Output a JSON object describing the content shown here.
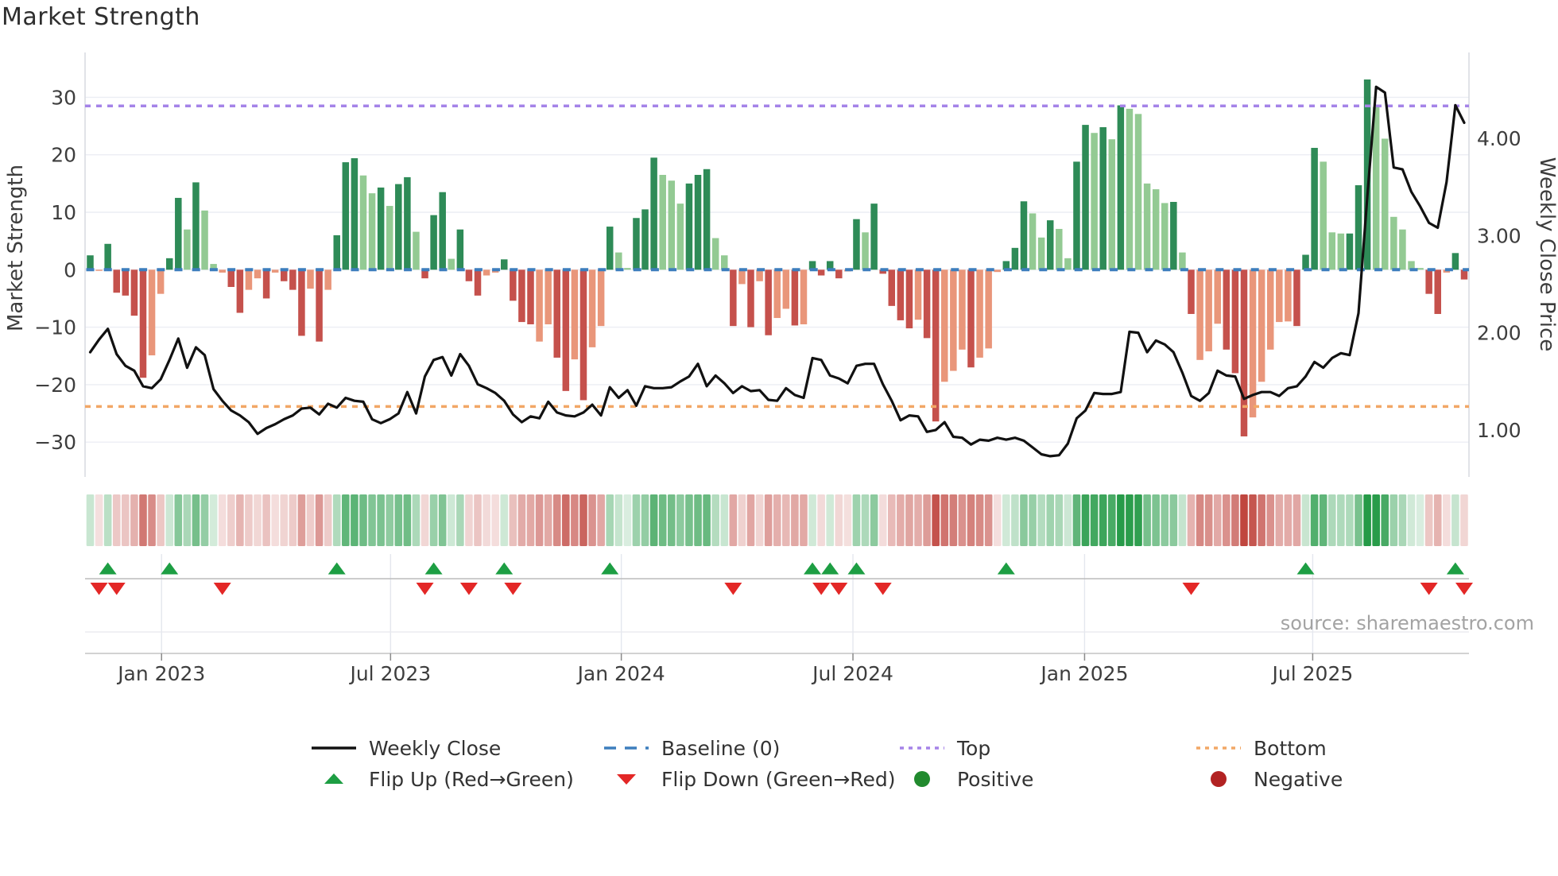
{
  "header": {
    "title": "Market Strength"
  },
  "source": "source: sharemaestro.com",
  "colors": {
    "bar_pos_dark": "#2e8b57",
    "bar_pos_light": "#93ca93",
    "bar_neg_dark": "#c5514c",
    "bar_neg_light": "#e9967a",
    "price_line": "#111111",
    "baseline": "#3d7ebd",
    "top_line": "#a583e8",
    "bottom_line": "#f2a766",
    "flip_up": "#1d9e43",
    "flip_down": "#e32726",
    "positive_dot": "#218a2e",
    "negative_dot": "#b22222",
    "heat_green": "#259a47",
    "heat_red": "#c0463f",
    "grid": "#eceef4",
    "spine": "#d7dae1",
    "axis_text": "#3d3d3d",
    "source_text": "#a3a3a3"
  },
  "chart_data": {
    "type": "bar",
    "subtype": "strength-bars + price line + heatmap + flip markers",
    "title": "Market Strength",
    "frequency": "weekly",
    "start_week": "2022-11-06",
    "n_weeks": 157,
    "left_axis": {
      "label": "Market Strength",
      "tick_labels": [
        "30",
        "20",
        "10",
        "0",
        "−10",
        "−20",
        "−30"
      ],
      "tick_values": [
        30,
        20,
        10,
        0,
        -10,
        -20,
        -30
      ],
      "range": [
        -37,
        37.8
      ]
    },
    "right_axis": {
      "label": "Weekly Close Price",
      "tick_labels": [
        "4.00",
        "3.00",
        "2.00",
        "1.00"
      ],
      "tick_values": [
        4,
        3,
        2,
        1
      ]
    },
    "x_ticks": [
      {
        "label": "Jan 2023",
        "week": 8.1
      },
      {
        "label": "Jul 2023",
        "week": 34.1
      },
      {
        "label": "Jan 2024",
        "week": 60.3
      },
      {
        "label": "Jul 2024",
        "week": 86.6
      },
      {
        "label": "Jan 2025",
        "week": 112.9
      },
      {
        "label": "Jul 2025",
        "week": 138.8
      }
    ],
    "baseline_value": 0,
    "top_value": 28.5,
    "bottom_value": -23.8,
    "strength": [
      2.5,
      -0.2,
      4.5,
      -4,
      -4.5,
      -8,
      -18.8,
      -14.9,
      -4.2,
      2,
      12.5,
      7,
      15.2,
      10.3,
      1,
      -0.5,
      -3,
      -7.5,
      -3.5,
      -1.5,
      -5,
      -0.5,
      -2,
      -3.5,
      -11.5,
      -3.3,
      -12.5,
      -3.5,
      6,
      18.7,
      19.4,
      16.4,
      13.3,
      14.3,
      11.1,
      14.9,
      16.1,
      6.6,
      -1.5,
      9.5,
      13.5,
      1.9,
      7,
      -2,
      -4.5,
      -1,
      -0.5,
      1.8,
      -5.4,
      -9.1,
      -9.5,
      -12.5,
      -9.5,
      -15.3,
      -21.1,
      -15.6,
      -22.7,
      -13.5,
      -9.8,
      7.5,
      3,
      0.3,
      9,
      10.5,
      19.5,
      16.5,
      15.5,
      11.5,
      15,
      16.5,
      17.5,
      5.5,
      2.5,
      -9.8,
      -2.5,
      -10,
      -2,
      -11.4,
      -8.4,
      -6.8,
      -9.7,
      -9.5,
      1.5,
      -1,
      1.5,
      -1.5,
      -0.3,
      8.8,
      6.5,
      11.5,
      -0.7,
      -6.3,
      -8.8,
      -10.2,
      -8.7,
      -11.9,
      -26.4,
      -19.5,
      -17.6,
      -13.9,
      -17,
      -15.3,
      -13.7,
      -0.4,
      1.5,
      3.8,
      11.9,
      9.8,
      5.6,
      8.6,
      7.1,
      2,
      18.8,
      25.2,
      23.8,
      24.8,
      22.7,
      28.6,
      28,
      27.1,
      15,
      14,
      11.6,
      11.8,
      3,
      -7.7,
      -15.7,
      -14.2,
      -9.4,
      -13.9,
      -18,
      -29,
      -25.7,
      -19.5,
      -13.9,
      -9.1,
      -9,
      -9.8,
      2.6,
      21.2,
      18.8,
      6.5,
      6.3,
      6.3,
      14.7,
      33.1,
      28.3,
      22.8,
      9.2,
      7,
      1.5,
      0.3,
      -4.2,
      -7.7,
      -0.5,
      2.9,
      -1.7
    ],
    "shade": "DLDDDDDLLDDLDLLLDDLLDLDDDLDLDDDLLDLDDLDDDLDDDLLDDDDLLDDLDLLDLLDDDLLLDDDLLDLDLDLLDLDDDDLDLDDDDDLDDLLLDLLLDDDLLDLLDDLDLDLLLLLDLDLLLDDDLLLLLDDDLLLDDDLLLLLLDDLDD",
    "price": [
      1.8,
      1.93,
      2.04,
      1.78,
      1.66,
      1.61,
      1.45,
      1.43,
      1.52,
      1.72,
      1.94,
      1.64,
      1.85,
      1.77,
      1.42,
      1.3,
      1.2,
      1.15,
      1.08,
      0.96,
      1.02,
      1.06,
      1.11,
      1.15,
      1.22,
      1.23,
      1.16,
      1.27,
      1.23,
      1.33,
      1.3,
      1.29,
      1.11,
      1.07,
      1.11,
      1.17,
      1.39,
      1.17,
      1.55,
      1.72,
      1.75,
      1.56,
      1.78,
      1.66,
      1.47,
      1.43,
      1.38,
      1.3,
      1.16,
      1.08,
      1.14,
      1.12,
      1.29,
      1.18,
      1.15,
      1.14,
      1.18,
      1.26,
      1.15,
      1.44,
      1.33,
      1.41,
      1.25,
      1.45,
      1.43,
      1.43,
      1.44,
      1.5,
      1.55,
      1.68,
      1.45,
      1.56,
      1.48,
      1.38,
      1.45,
      1.4,
      1.41,
      1.31,
      1.3,
      1.43,
      1.36,
      1.33,
      1.74,
      1.72,
      1.56,
      1.53,
      1.48,
      1.66,
      1.68,
      1.68,
      1.47,
      1.3,
      1.1,
      1.15,
      1.14,
      0.98,
      1.0,
      1.08,
      0.93,
      0.92,
      0.85,
      0.9,
      0.89,
      0.92,
      0.9,
      0.92,
      0.89,
      0.82,
      0.75,
      0.73,
      0.74,
      0.86,
      1.12,
      1.2,
      1.38,
      1.37,
      1.37,
      1.39,
      2.01,
      2.0,
      1.8,
      1.92,
      1.88,
      1.8,
      1.59,
      1.35,
      1.3,
      1.38,
      1.61,
      1.56,
      1.55,
      1.32,
      1.36,
      1.39,
      1.39,
      1.35,
      1.43,
      1.45,
      1.55,
      1.7,
      1.64,
      1.74,
      1.79,
      1.77,
      2.2,
      3.4,
      4.53,
      4.47,
      3.7,
      3.68,
      3.45,
      3.3,
      3.13,
      3.08,
      3.55,
      4.34,
      4.16
    ],
    "flip_up_weeks": [
      2,
      9,
      28,
      39,
      47,
      59,
      82,
      84,
      87,
      104,
      138,
      155
    ],
    "flip_down_weeks": [
      1,
      3,
      15,
      38,
      43,
      48,
      73,
      83,
      85,
      90,
      125,
      152,
      156
    ],
    "legend_position": "bottom",
    "grid": "horizontal-only"
  },
  "legend": {
    "rows": [
      [
        {
          "type": "line-black",
          "label": "Weekly Close"
        },
        {
          "type": "dash-blue",
          "label": "Baseline (0)"
        },
        {
          "type": "dot-purple",
          "label": "Top"
        },
        {
          "type": "dot-orange",
          "label": "Bottom"
        }
      ],
      [
        {
          "type": "tri-up",
          "label": "Flip Up (Red→Green)"
        },
        {
          "type": "tri-down",
          "label": "Flip Down (Green→Red)"
        },
        {
          "type": "dot-green",
          "label": "Positive"
        },
        {
          "type": "dot-red",
          "label": "Negative"
        }
      ]
    ]
  }
}
